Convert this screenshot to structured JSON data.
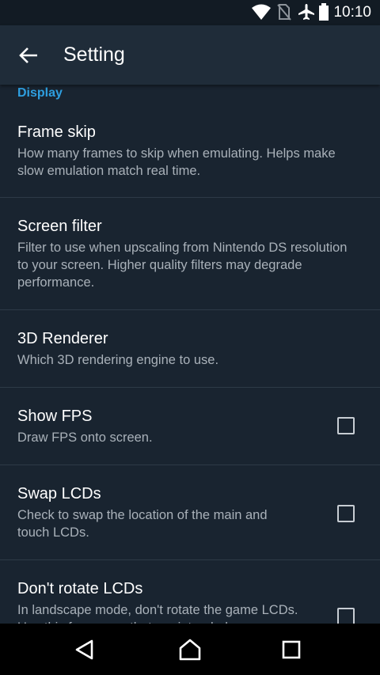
{
  "status_bar": {
    "time": "10:10",
    "icons": [
      "wifi-icon",
      "no-sim-icon",
      "airplane-mode-icon",
      "battery-icon"
    ]
  },
  "app_bar": {
    "title": "Setting",
    "back_icon": "arrow-back-icon"
  },
  "section": {
    "header": "Display"
  },
  "preferences": [
    {
      "title": "Frame skip",
      "summary": "How many frames to skip when emulating. Helps make slow emulation match real time.",
      "has_checkbox": false
    },
    {
      "title": "Screen filter",
      "summary": "Filter to use when upscaling from Nintendo DS resolution to your screen. Higher quality filters may degrade performance.",
      "has_checkbox": false
    },
    {
      "title": "3D Renderer",
      "summary": "Which 3D rendering engine to use.",
      "has_checkbox": false
    },
    {
      "title": "Show FPS",
      "summary": "Draw FPS onto screen.",
      "has_checkbox": true,
      "checked": false
    },
    {
      "title": "Swap LCDs",
      "summary": "Check to swap the location of the main and touch LCDs.",
      "has_checkbox": true,
      "checked": false
    },
    {
      "title": "Don't rotate LCDs",
      "summary": "In landscape mode, don't rotate the game LCDs. Use this for games that are intended",
      "has_checkbox": true,
      "checked": false
    }
  ],
  "nav_bar": {
    "icons": [
      "back-triangle-icon",
      "home-icon",
      "recents-square-icon"
    ]
  },
  "colors": {
    "accent": "#2e9fe0",
    "background": "#192430",
    "app_bar": "#1f2c39"
  }
}
